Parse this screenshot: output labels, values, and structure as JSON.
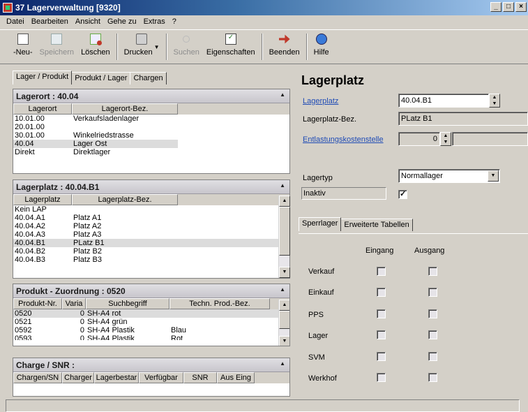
{
  "window": {
    "title": "37 Lagerverwaltung [9320]",
    "min": "_",
    "max": "□",
    "close": "×"
  },
  "menu": [
    "Datei",
    "Bearbeiten",
    "Ansicht",
    "Gehe zu",
    "Extras",
    "?"
  ],
  "toolbar": {
    "new": "-Neu-",
    "save": "Speichern",
    "delete": "Löschen",
    "print": "Drucken",
    "search": "Suchen",
    "properties": "Eigenschaften",
    "exit": "Beenden",
    "help": "Hilfe"
  },
  "left_tabs": [
    "Lager / Produkt",
    "Produkt / Lager",
    "Chargen"
  ],
  "lagerort": {
    "title": "Lagerort : 40.04",
    "headers": [
      "Lagerort",
      "Lagerort-Bez."
    ],
    "rows": [
      [
        "10.01.00",
        "Verkaufsladenlager"
      ],
      [
        "20.01.00",
        ""
      ],
      [
        "30.01.00",
        "Winkelriedstrasse"
      ],
      [
        "40.04",
        "Lager Ost"
      ],
      [
        "Direkt",
        "Direktlager"
      ]
    ],
    "selected": 3
  },
  "lagerplatz": {
    "title": "Lagerplatz : 40.04.B1",
    "headers": [
      "Lagerplatz",
      "Lagerplatz-Bez."
    ],
    "rows": [
      [
        "Kein LAP",
        ""
      ],
      [
        "40.04.A1",
        "Platz A1"
      ],
      [
        "40.04.A2",
        "Platz A2"
      ],
      [
        "40.04.A3",
        "Platz A3"
      ],
      [
        "40.04.B1",
        "PLatz B1"
      ],
      [
        "40.04.B2",
        "Platz B2"
      ],
      [
        "40.04.B3",
        "Platz B3"
      ]
    ],
    "selected": 4
  },
  "produkt": {
    "title": "Produkt - Zuordnung : 0520",
    "headers": [
      "Produkt-Nr.",
      "Varia",
      "Suchbegriff",
      "Techn. Prod.-Bez."
    ],
    "rows": [
      [
        "0520",
        "0",
        "SH-A4 rot",
        ""
      ],
      [
        "0521",
        "0",
        "SH-A4 grün",
        ""
      ],
      [
        "0592",
        "0",
        "SH-A4 Plastik",
        "Blau"
      ],
      [
        "0593",
        "0",
        "SH-A4 Plastik",
        "Rot"
      ]
    ],
    "selected": 0
  },
  "charge": {
    "title": "Charge / SNR :",
    "headers": [
      "Chargen/SN",
      "Charger",
      "Lagerbestar",
      "Verfügbar",
      "SNR",
      "Aus Eing"
    ]
  },
  "detail": {
    "title": "Lagerplatz",
    "lagerplatz_label": "Lagerplatz",
    "lagerplatz_value": "40.04.B1",
    "bez_label": "Lagerplatz-Bez.",
    "bez_value": "PLatz B1",
    "kst_label": "Entlastungskostenstelle",
    "kst_value": "0",
    "lagertyp_label": "Lagertyp",
    "lagertyp_value": "Normallager",
    "inaktiv_label": "Inaktiv"
  },
  "right_tabs": [
    "Sperrlager",
    "Erweiterte Tabellen"
  ],
  "sperrlager": {
    "col_eingang": "Eingang",
    "col_ausgang": "Ausgang",
    "rows": [
      "Verkauf",
      "Einkauf",
      "PPS",
      "Lager",
      "SVM",
      "Werkhof"
    ]
  },
  "icons": {
    "new": "new-document-icon",
    "save": "save-icon",
    "delete": "delete-icon",
    "print": "printer-icon",
    "search": "search-icon",
    "properties": "properties-icon",
    "exit": "exit-icon",
    "help": "help-icon"
  }
}
